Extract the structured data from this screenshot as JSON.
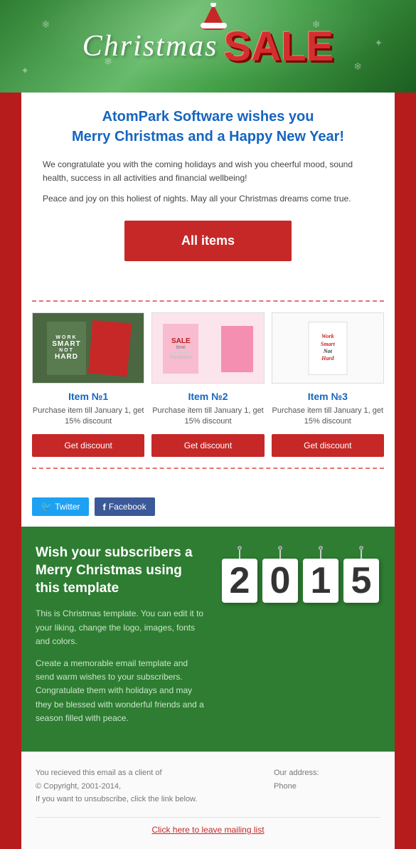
{
  "header": {
    "christmas_text": "Christmas",
    "sale_text": "SALE"
  },
  "greeting": {
    "title": "AtomPark Software wishes you\nMerry Christmas and a Happy New Year!",
    "body1": "We congratulate you with the coming holidays and wish you cheerful mood, sound health, success in all activities and financial wellbeing!",
    "body2": "Peace and joy on this holiest of nights. May all your Christmas dreams come true."
  },
  "cta": {
    "all_items_label": "All items"
  },
  "products": [
    {
      "id": "1",
      "title": "Item №1",
      "description": "Purchase item till January 1, get 15% discount",
      "button_label": "Get discount",
      "card_line1": "WORK",
      "card_line2": "SMART",
      "card_line3": "NOT",
      "card_line4": "HARD"
    },
    {
      "id": "2",
      "title": "Item №2",
      "description": "Purchase item till January 1, get 15% discount",
      "button_label": "Get discount",
      "card_text": "SALE time"
    },
    {
      "id": "3",
      "title": "Item №3",
      "description": "Purchase item till January 1, get 15% discount",
      "button_label": "Get discount",
      "card_text": "Work Smart Not Hard"
    }
  ],
  "social": {
    "twitter_label": "Twitter",
    "facebook_label": "Facebook"
  },
  "promo": {
    "title": "Wish your subscribers a Merry Christmas using this template",
    "body1": "This is Christmas template. You can edit it to your liking, change the logo, images, fonts and colors.",
    "body2": "Create a memorable email template and send warm wishes to your subscribers. Congratulate them with holidays and may they be blessed with wonderful friends and a season filled with peace.",
    "year": "2015",
    "digit1": "2",
    "digit2": "0",
    "digit3": "1",
    "digit4": "5"
  },
  "footer": {
    "left_line1": "You recieved this email as a client of",
    "left_line2": "© Copyright, 2001-2014,",
    "left_line3": "If you want to unsubscribe, click the link below.",
    "right_line1": "Our address:",
    "right_line2": "",
    "right_line3": "Phone",
    "unsubscribe_label": "Click here to leave mailing list"
  },
  "colors": {
    "red": "#c62828",
    "dark_red": "#b71c1c",
    "green": "#2e7d32",
    "blue": "#1565c0",
    "twitter_blue": "#1da1f2",
    "facebook_blue": "#3b5998"
  }
}
